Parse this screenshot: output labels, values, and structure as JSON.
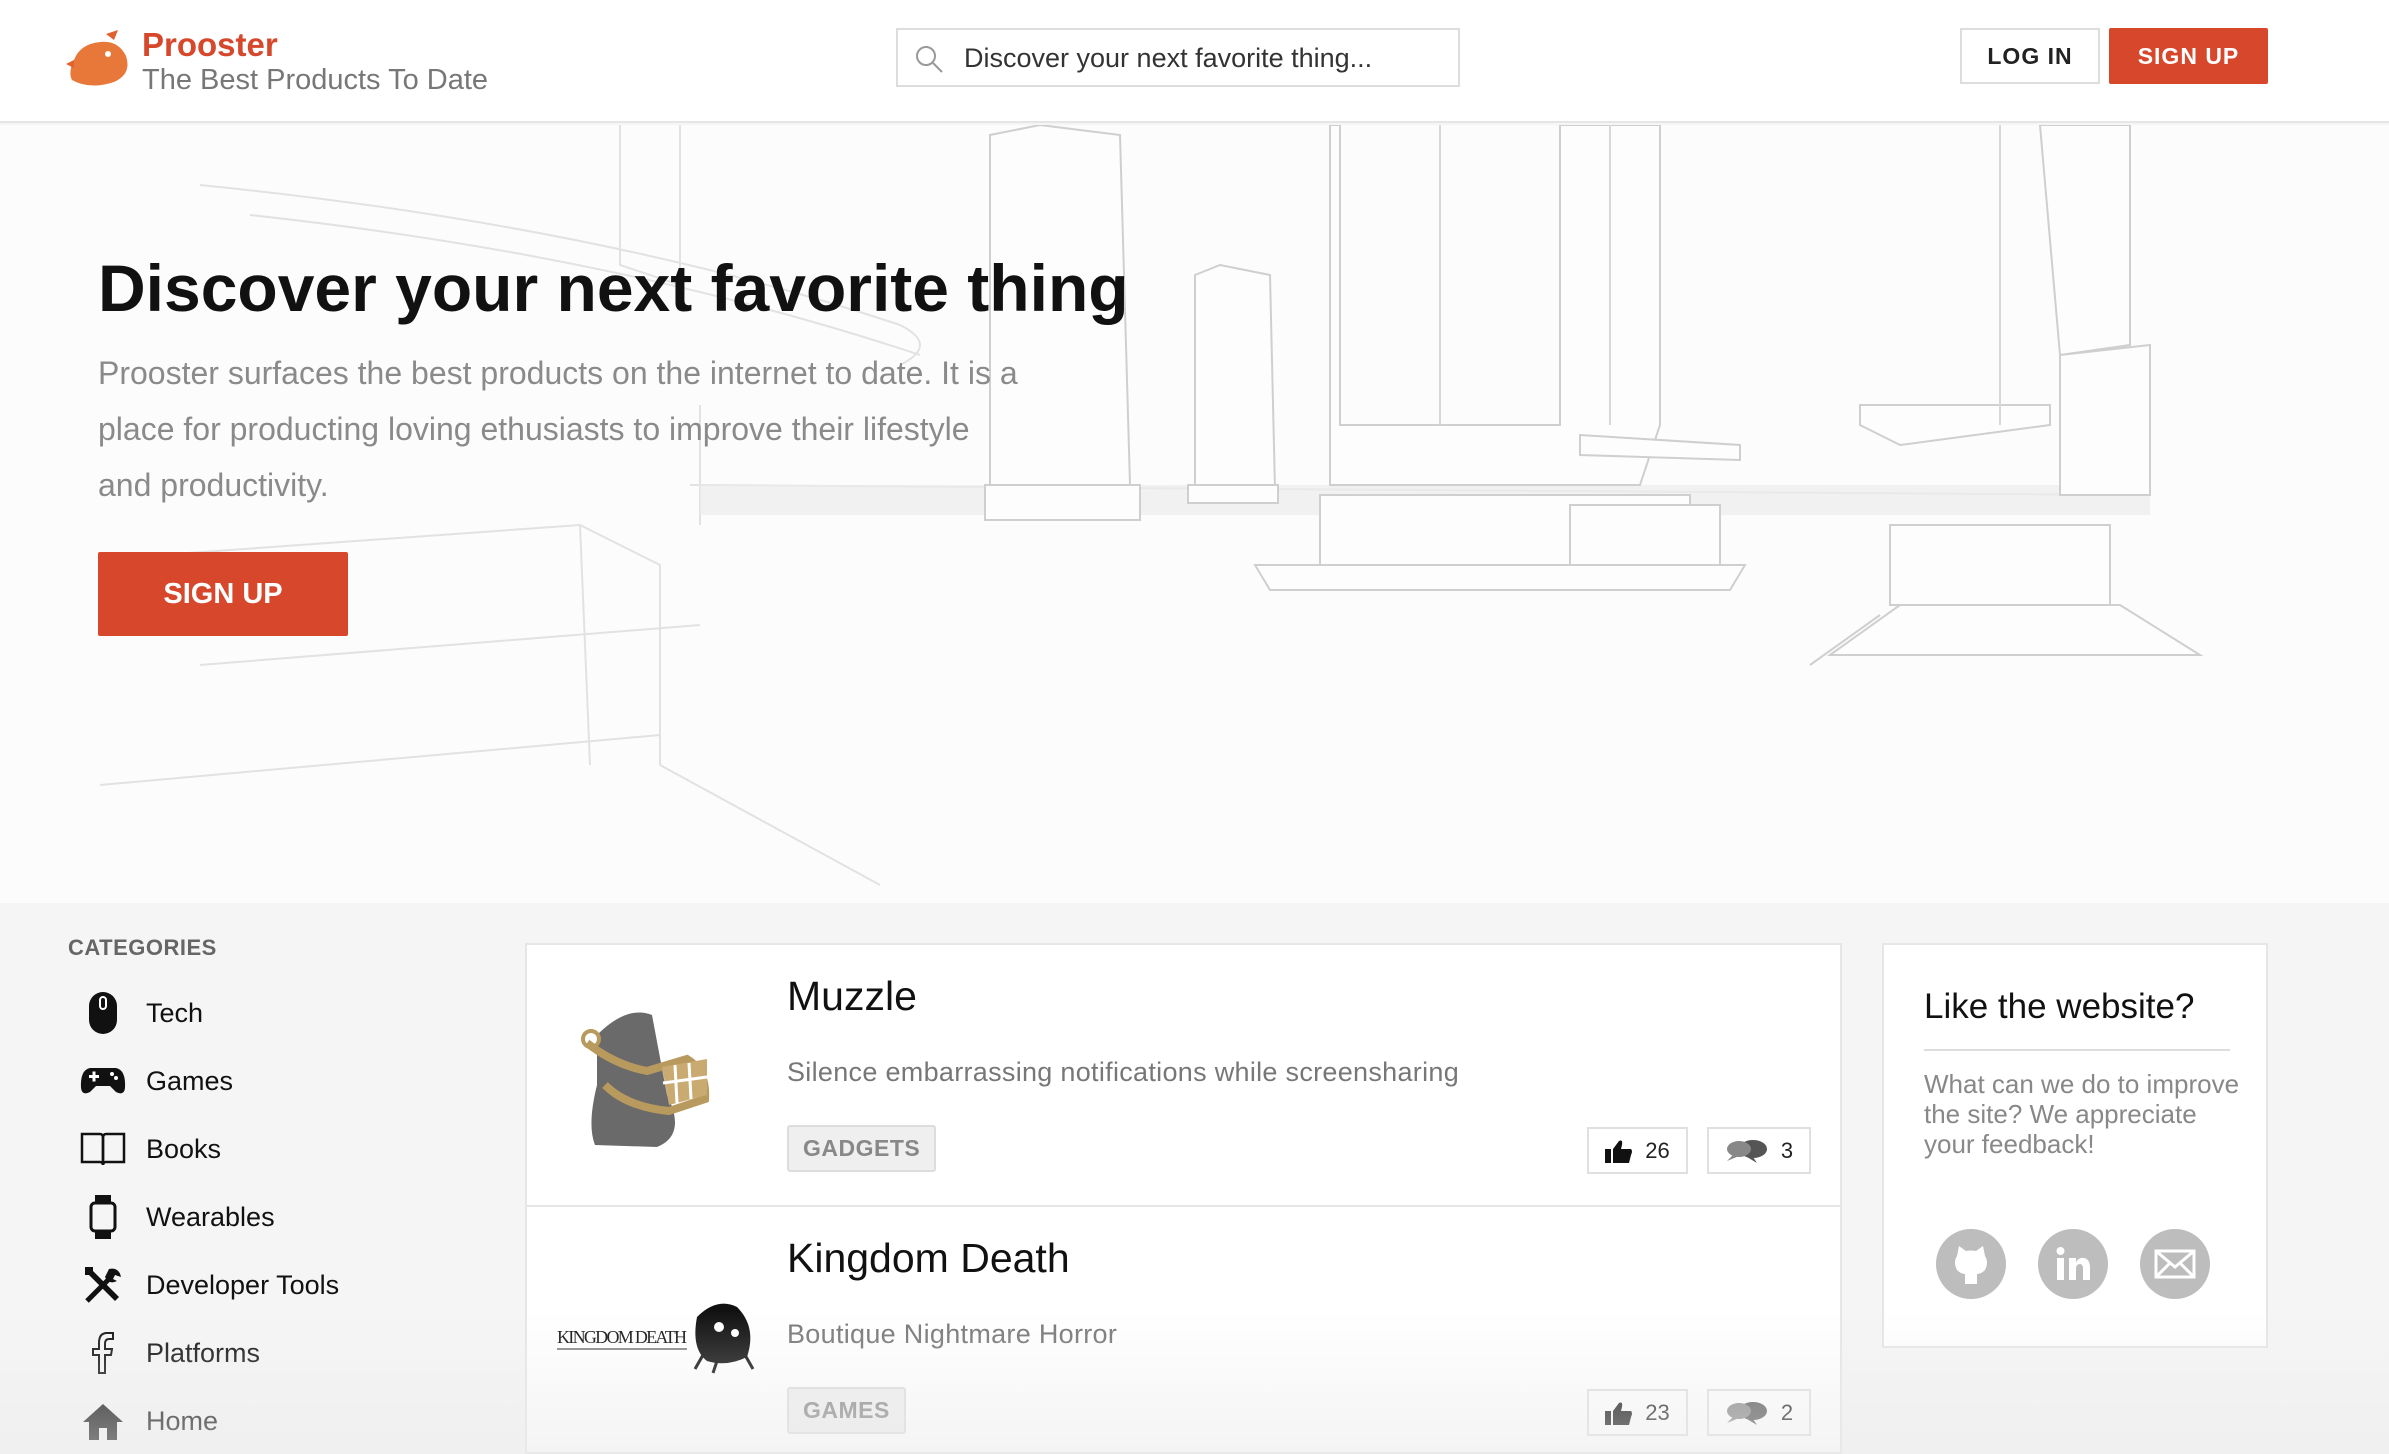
{
  "header": {
    "brand_name": "Prooster",
    "tagline": "The Best Products To Date",
    "search_placeholder": "Discover your next favorite thing...",
    "login_label": "LOG IN",
    "signup_label": "SIGN UP"
  },
  "hero": {
    "title": "Discover your next favorite thing",
    "description": "Prooster surfaces the best products on the internet to date. It is a place for producting loving ethusiasts to improve their lifestyle and productivity.",
    "signup_label": "SIGN UP"
  },
  "sidebar": {
    "heading": "CATEGORIES",
    "items": [
      {
        "label": "Tech",
        "icon": "mouse-icon"
      },
      {
        "label": "Games",
        "icon": "gamepad-icon"
      },
      {
        "label": "Books",
        "icon": "book-icon"
      },
      {
        "label": "Wearables",
        "icon": "watch-icon"
      },
      {
        "label": "Developer Tools",
        "icon": "tools-icon"
      },
      {
        "label": "Platforms",
        "icon": "facebook-icon"
      },
      {
        "label": "Home",
        "icon": "home-icon"
      }
    ]
  },
  "products": [
    {
      "name": "Muzzle",
      "description": "Silence embarrassing notifications while screensharing",
      "tag": "GADGETS",
      "upvotes": "26",
      "comments": "3"
    },
    {
      "name": "Kingdom Death",
      "description": "Boutique Nightmare Horror",
      "tag": "GAMES",
      "upvotes": "23",
      "comments": "2",
      "logo_text": "KINGDOM DEATH"
    }
  ],
  "feedback": {
    "title": "Like the website?",
    "text": "What can we do to improve the site? We appreciate your feedback!",
    "icons": [
      "github-icon",
      "linkedin-icon",
      "mail-icon"
    ]
  },
  "colors": {
    "accent": "#d6472b",
    "muted_icon": "#bdbdbd"
  }
}
